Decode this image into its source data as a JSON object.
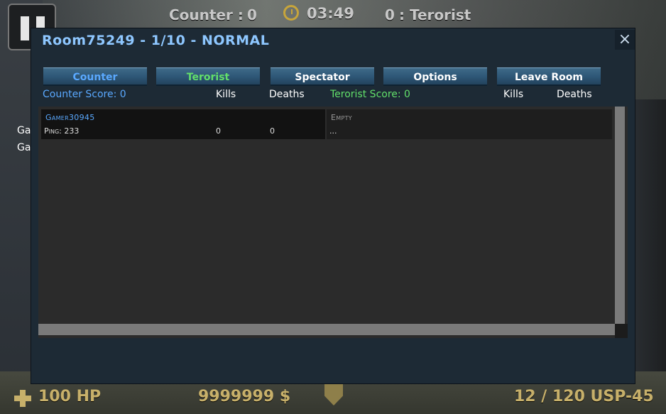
{
  "hud": {
    "counter_label": "Counter :",
    "counter_score": "0",
    "timer": "03:49",
    "terorist_score": "0",
    "terorist_label": ": Terorist",
    "hp": "100 HP",
    "money": "9999999 $",
    "ammo": "12 / 120 USP-45",
    "side_hint_1": "Ga",
    "side_hint_2": "Ga"
  },
  "modal": {
    "title": "Room75249 - 1/10 - NORMAL",
    "close_label": "×",
    "tabs": [
      {
        "label": "Counter"
      },
      {
        "label": "Terorist"
      },
      {
        "label": "Spectator"
      },
      {
        "label": "Options"
      },
      {
        "label": "Leave Room"
      }
    ],
    "counter_score_label": "Counter Score: 0",
    "terorist_score_label": "Terorist Score: 0",
    "kills_label": "Kills",
    "deaths_label": "Deaths"
  },
  "counter_team": {
    "player": {
      "name": "Gamer30945",
      "ping": "Ping: 233",
      "kills": "0",
      "deaths": "0"
    }
  },
  "terorist_team": {
    "slot": {
      "name": "Empty",
      "detail": "..."
    }
  },
  "colors": {
    "counter": "#5aa9ff",
    "terorist": "#62e06a",
    "modal_bg": "#1d2a35",
    "hud_gold": "#c7b06a"
  }
}
